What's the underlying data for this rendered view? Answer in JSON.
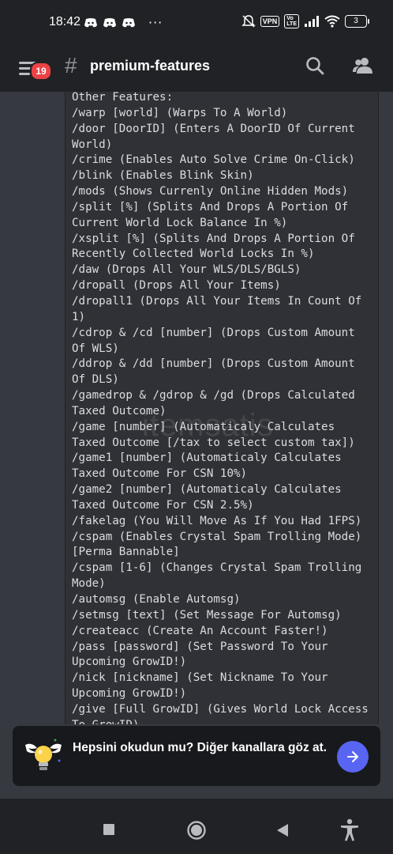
{
  "status_bar": {
    "time": "18:42",
    "dots": "···",
    "vpn": "VPN",
    "volte": "Vo\nLTE",
    "battery": "3"
  },
  "header": {
    "notification_count": "19",
    "hash": "#",
    "channel_name": "premium-features"
  },
  "message": {
    "lines": [
      "Other Features:",
      "/warp [world] (Warps To A World)",
      "/door [DoorID] (Enters A DoorID Of Current",
      "World)",
      "/crime (Enables Auto Solve Crime On-Click)",
      "/blink (Enables Blink Skin)",
      "/mods (Shows Currenly Online Hidden Mods)",
      "/split [%] (Splits And Drops A Portion Of",
      "Current World Lock Balance In %)",
      "/xsplit [%] (Splits And Drops A Portion Of",
      "Recently Collected World Locks In %)",
      "/daw (Drops All Your WLS/DLS/BGLS)",
      "/dropall (Drops All Your Items)",
      "/dropall1 (Drops All Your Items In Count Of",
      "1)",
      "/cdrop & /cd [number] (Drops Custom Amount",
      "Of WLS)",
      "/ddrop & /dd [number] (Drops Custom Amount",
      "Of DLS)",
      "/gamedrop & /gdrop & /gd (Drops Calculated",
      "Taxed Outcome)",
      "/game [number] (Automaticaly Calculates",
      "Taxed Outcome [/tax to select custom tax])",
      "/game1 [number] (Automaticaly Calculates",
      "Taxed Outcome For CSN 10%)",
      "/game2 [number] (Automaticaly Calculates",
      "Taxed Outcome For CSN 2.5%)",
      "/fakelag (You Will Move As If You Had 1FPS)",
      "/cspam (Enables Crystal Spam Trolling Mode)",
      "[Perma Bannable]",
      "/cspam [1-6] (Changes Crystal Spam Trolling",
      "Mode)",
      "/automsg (Enable Automsg)",
      "/setmsg [text] (Set Message For Automsg)",
      "/createacc (Create An Account Faster!)",
      "/pass [password] (Set Password To Your",
      "Upcoming GrowID!)",
      "/nick [nickname] (Set Nickname To Your",
      "Upcoming GrowID!)",
      "/give [Full GrowID] (Gives World Lock Access",
      "To GrowID)"
    ]
  },
  "watermark": "itemsatis",
  "banner": {
    "text": "Hepsini okudun mu? Diğer kanallara göz at."
  },
  "colors": {
    "background": "#36393f",
    "header": "#202225",
    "codeblock": "#2f3136",
    "badge": "#ed4245",
    "accent": "#5865f2"
  },
  "icons": {
    "menu": "hamburger-menu-icon",
    "search": "search-icon",
    "members": "members-icon",
    "banner": "winged-lightbulb-icon",
    "arrow": "arrow-right-icon"
  }
}
